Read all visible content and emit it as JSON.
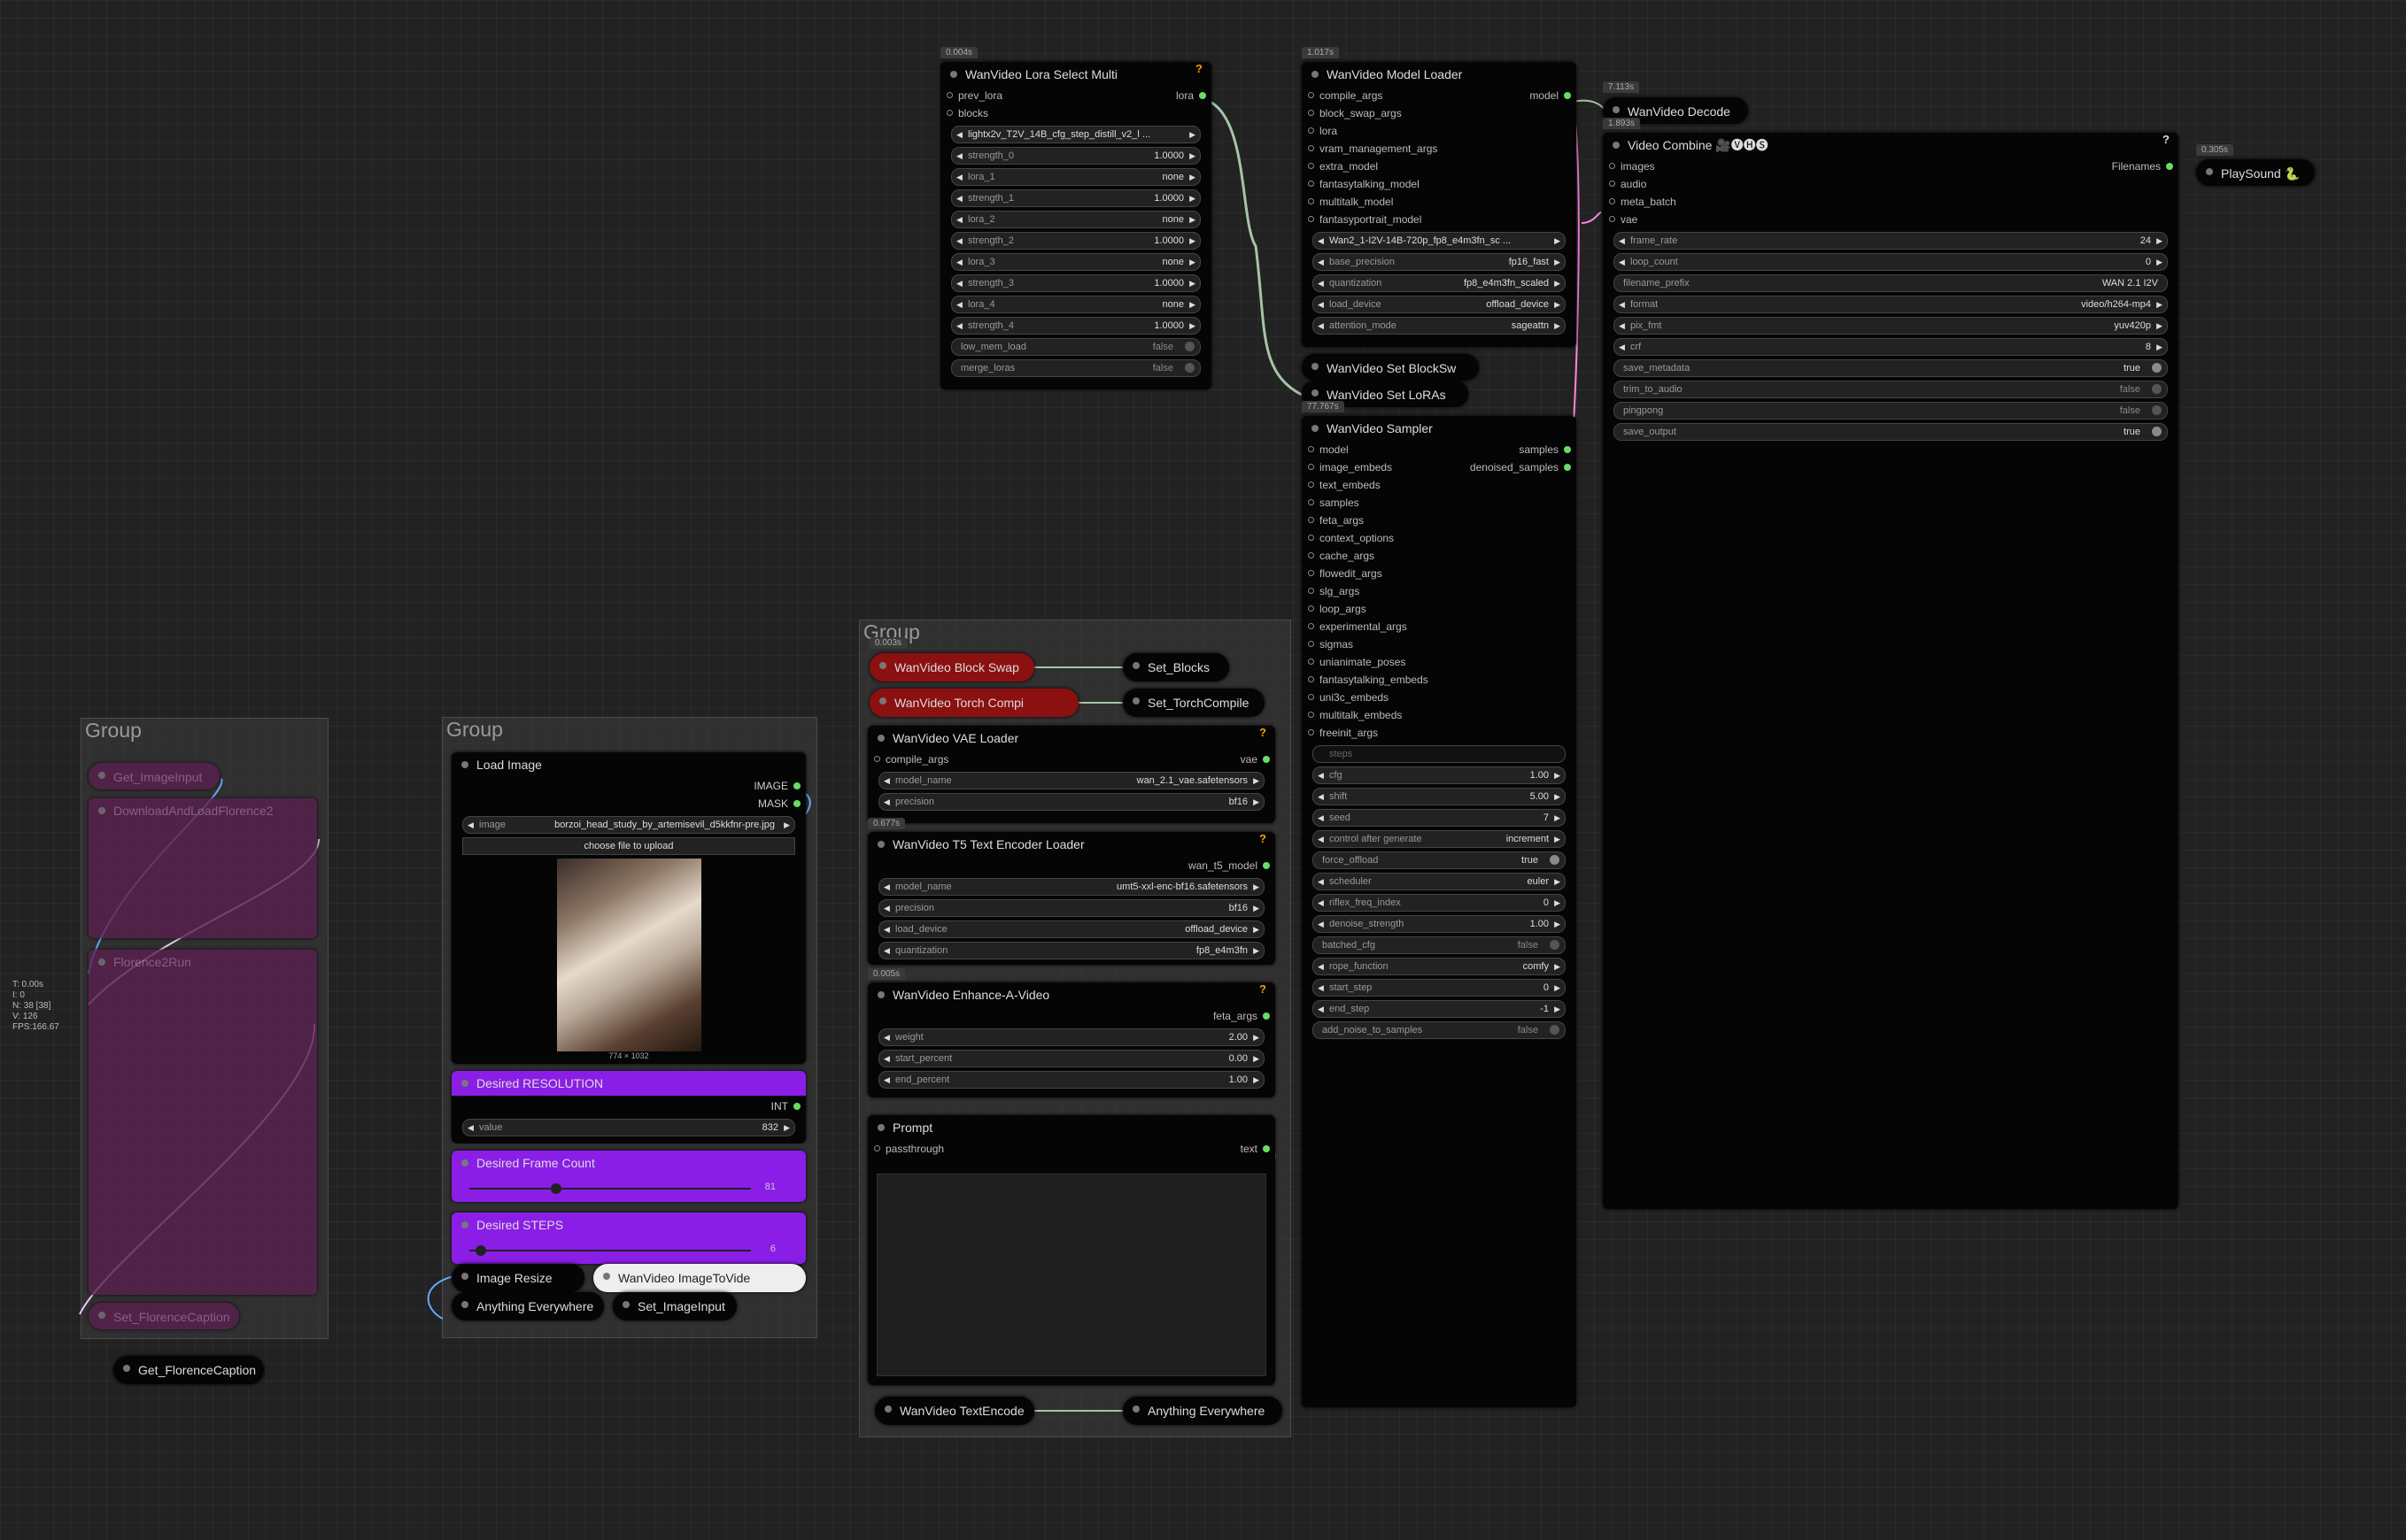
{
  "stats": [
    "T: 0.00s",
    "I: 0",
    "N: 38 [38]",
    "V: 126",
    "FPS:166.67"
  ],
  "groups": {
    "g1": "Group",
    "g2": "Group",
    "g3": "Group"
  },
  "lora": {
    "ts": "0.004s",
    "title": "WanVideo Lora Select Multi",
    "inputs": [
      "prev_lora",
      "blocks"
    ],
    "output": "lora",
    "widgets": [
      {
        "n": "",
        "v": "lightx2v_T2V_14B_cfg_step_distill_v2_l ..."
      },
      {
        "n": "strength_0",
        "v": "1.0000"
      },
      {
        "n": "lora_1",
        "v": "none"
      },
      {
        "n": "strength_1",
        "v": "1.0000"
      },
      {
        "n": "lora_2",
        "v": "none"
      },
      {
        "n": "strength_2",
        "v": "1.0000"
      },
      {
        "n": "lora_3",
        "v": "none"
      },
      {
        "n": "strength_3",
        "v": "1.0000"
      },
      {
        "n": "lora_4",
        "v": "none"
      },
      {
        "n": "strength_4",
        "v": "1.0000"
      }
    ],
    "toggles": [
      {
        "n": "low_mem_load",
        "v": "false"
      },
      {
        "n": "merge_loras",
        "v": "false"
      }
    ]
  },
  "model": {
    "ts": "1.017s",
    "title": "WanVideo Model Loader",
    "output": "model",
    "inputs": [
      "compile_args",
      "block_swap_args",
      "lora",
      "vram_management_args",
      "extra_model",
      "fantasytalking_model",
      "multitalk_model",
      "fantasyportrait_model"
    ],
    "widgets": [
      {
        "n": "",
        "v": "Wan2_1-I2V-14B-720p_fp8_e4m3fn_sc ..."
      },
      {
        "n": "base_precision",
        "v": "fp16_fast"
      },
      {
        "n": "quantization",
        "v": "fp8_e4m3fn_scaled"
      },
      {
        "n": "load_device",
        "v": "offload_device"
      },
      {
        "n": "attention_mode",
        "v": "sageattn"
      }
    ]
  },
  "blockswap": {
    "title": "WanVideo Set BlockSw"
  },
  "setloras": {
    "title": "WanVideo Set LoRAs"
  },
  "decode": {
    "ts": "7.113s",
    "title": "WanVideo Decode"
  },
  "combine": {
    "ts": "1.893s",
    "title": "Video Combine 🎥🅥🅗🅢",
    "output": "Filenames",
    "inputs": [
      "images",
      "audio",
      "meta_batch",
      "vae"
    ],
    "widgets": [
      {
        "n": "frame_rate",
        "v": "24"
      },
      {
        "n": "loop_count",
        "v": "0"
      },
      {
        "n": "filename_prefix",
        "v": "WAN 2.1 I2V"
      },
      {
        "n": "format",
        "v": "video/h264-mp4"
      },
      {
        "n": "pix_fmt",
        "v": "yuv420p"
      },
      {
        "n": "crf",
        "v": "8"
      }
    ],
    "toggles": [
      {
        "n": "save_metadata",
        "v": "true"
      },
      {
        "n": "trim_to_audio",
        "v": "false"
      },
      {
        "n": "pingpong",
        "v": "false"
      },
      {
        "n": "save_output",
        "v": "true"
      }
    ]
  },
  "playsound": {
    "ts": "0.305s",
    "title": "PlaySound 🐍"
  },
  "sampler": {
    "ts": "77.767s",
    "title": "WanVideo Sampler",
    "outputs": [
      "samples",
      "denoised_samples"
    ],
    "inputs": [
      "model",
      "image_embeds",
      "text_embeds",
      "samples",
      "feta_args",
      "context_options",
      "cache_args",
      "flowedit_args",
      "slg_args",
      "loop_args",
      "experimental_args",
      "sigmas",
      "unianimate_poses",
      "fantasytalking_embeds",
      "uni3c_embeds",
      "multitalk_embeds",
      "freeinit_args"
    ],
    "steps": "steps",
    "widgets": [
      {
        "n": "cfg",
        "v": "1.00"
      },
      {
        "n": "shift",
        "v": "5.00"
      },
      {
        "n": "seed",
        "v": "7"
      },
      {
        "n": "control after generate",
        "v": "increment"
      }
    ],
    "force": {
      "n": "force_offload",
      "v": "true"
    },
    "widgets2": [
      {
        "n": "scheduler",
        "v": "euler"
      },
      {
        "n": "riflex_freq_index",
        "v": "0"
      },
      {
        "n": "denoise_strength",
        "v": "1.00"
      }
    ],
    "batched": {
      "n": "batched_cfg",
      "v": "false"
    },
    "widgets3": [
      {
        "n": "rope_function",
        "v": "comfy"
      },
      {
        "n": "start_step",
        "v": "0"
      },
      {
        "n": "end_step",
        "v": "-1"
      }
    ],
    "noise": {
      "n": "add_noise_to_samples",
      "v": "false"
    }
  },
  "blockswapnode": {
    "ts": "0.003s",
    "title": "WanVideo Block Swap",
    "set": "Set_Blocks"
  },
  "torch": {
    "title": "WanVideo Torch Compi",
    "set": "Set_TorchCompile"
  },
  "vae": {
    "ts": "",
    "title": "WanVideo VAE Loader",
    "input": "compile_args",
    "output": "vae",
    "widgets": [
      {
        "n": "model_name",
        "v": "wan_2.1_vae.safetensors"
      },
      {
        "n": "precision",
        "v": "bf16"
      }
    ]
  },
  "t5": {
    "ts": "0.677s",
    "title": "WanVideo T5 Text Encoder Loader",
    "output": "wan_t5_model",
    "widgets": [
      {
        "n": "model_name",
        "v": "umt5-xxl-enc-bf16.safetensors"
      },
      {
        "n": "precision",
        "v": "bf16"
      },
      {
        "n": "load_device",
        "v": "offload_device"
      },
      {
        "n": "quantization",
        "v": "fp8_e4m3fn"
      }
    ]
  },
  "enhance": {
    "ts": "0.005s",
    "title": "WanVideo Enhance-A-Video",
    "output": "feta_args",
    "widgets": [
      {
        "n": "weight",
        "v": "2.00"
      },
      {
        "n": "start_percent",
        "v": "0.00"
      },
      {
        "n": "end_percent",
        "v": "1.00"
      }
    ]
  },
  "prompt": {
    "title": "Prompt",
    "input": "passthrough",
    "output": "text"
  },
  "textencode": {
    "title": "WanVideo TextEncode",
    "any": "Anything Everywhere"
  },
  "loadimage": {
    "title": "Load Image",
    "outputs": [
      "IMAGE",
      "MASK"
    ],
    "image": {
      "n": "image",
      "v": "borzoi_head_study_by_artemisevil_d5kkfnr-pre.jpg"
    },
    "upload": "choose file to upload",
    "size": "774 × 1032"
  },
  "resolution": {
    "title": "Desired RESOLUTION",
    "output": "INT",
    "widget": {
      "n": "value",
      "v": "832"
    }
  },
  "framecount": {
    "title": "Desired Frame Count",
    "value": "81"
  },
  "steps": {
    "title": "Desired STEPS",
    "value": "6"
  },
  "resize": {
    "title": "Image Resize"
  },
  "imagetovid": {
    "title": "WanVideo ImageToVide"
  },
  "anything": {
    "title": "Anything Everywhere"
  },
  "setimage": {
    "title": "Set_ImageInput"
  },
  "florence": {
    "get": "Get_ImageInput",
    "download": "DownloadAndLoadFlorence2",
    "run": "Florence2Run",
    "set": "Set_FlorenceCaption",
    "getcap": "Get_FlorenceCaption"
  }
}
